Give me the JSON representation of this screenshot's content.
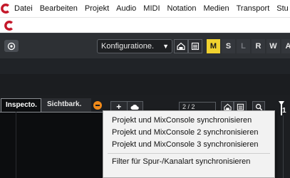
{
  "menubar": {
    "items": [
      "Datei",
      "Bearbeiten",
      "Projekt",
      "Audio",
      "MIDI",
      "Notation",
      "Medien",
      "Transport",
      "Stu"
    ]
  },
  "toolbar": {
    "config_label": "Konfiguratione.",
    "modes": [
      "M",
      "S",
      "L",
      "R",
      "W",
      "A"
    ]
  },
  "inspector": {
    "tab_inspector": "Inspecto.",
    "tab_visibility": "Sichtbark."
  },
  "tracklist": {
    "page_indicator": "2 / 2",
    "marker_number": "1"
  },
  "dropdown": {
    "items": [
      "Projekt und MixConsole synchronisieren",
      "Projekt und MixConsole 2 synchronisieren",
      "Projekt und MixConsole 3 synchronisieren",
      "Filter für Spur-/Kanalart synchronisieren"
    ]
  },
  "colors": {
    "accent_yellow": "#f1d22f",
    "orange": "#f08a1a",
    "logo_red": "#c4182a"
  }
}
